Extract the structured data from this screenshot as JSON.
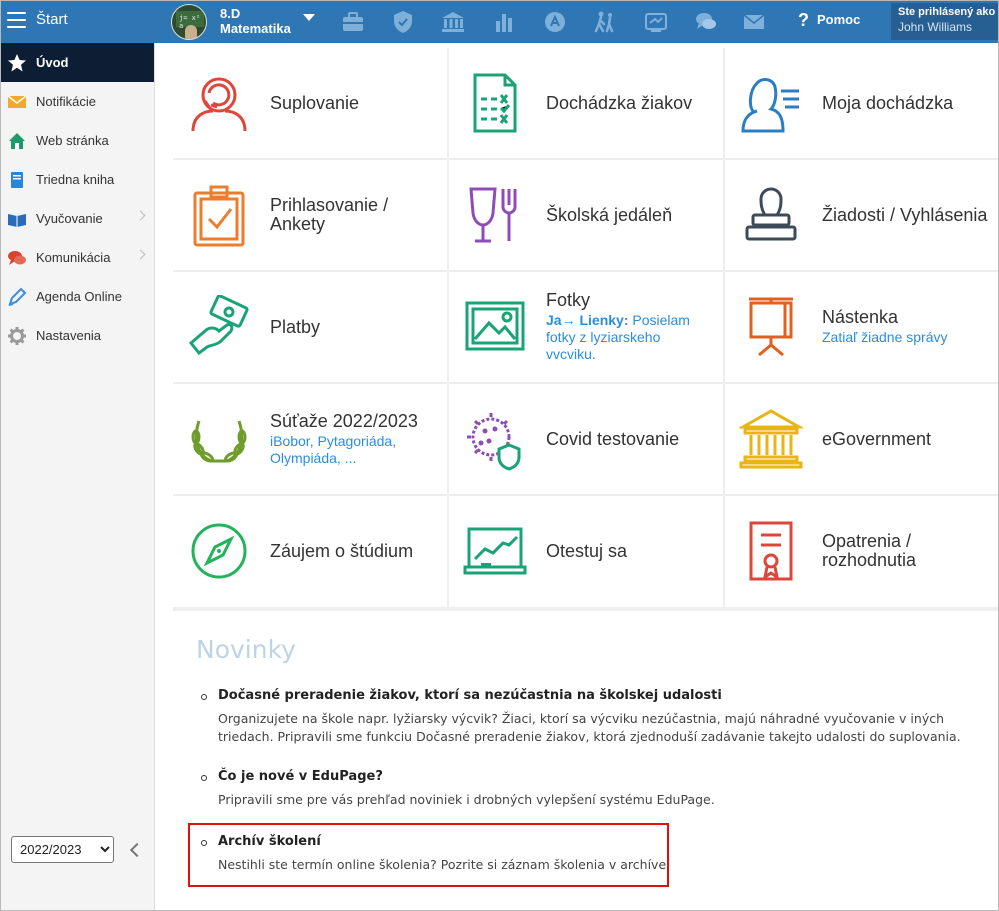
{
  "topbar": {
    "start_label": "Štart",
    "class_line1": "8.D",
    "class_line2": "Matematika",
    "class_avatar_chalk": "j= x² a",
    "icons": [
      "briefcase-icon",
      "shield-icon",
      "bank-icon",
      "bar-chart-icon",
      "teacher-icon",
      "walking-icon",
      "screen-cast-icon",
      "chat-icon",
      "mail-icon"
    ],
    "help_label": "Pomoc",
    "user_line1": "Ste prihlásený ako",
    "user_line2": "John Williams",
    "bar_color": "#2e77b4"
  },
  "sidebar": {
    "items": [
      {
        "label": "Úvod",
        "icon": "star-icon"
      },
      {
        "label": "Notifikácie",
        "icon": "envelope-icon"
      },
      {
        "label": "Web stránka",
        "icon": "home-icon"
      },
      {
        "label": "Triedna kniha",
        "icon": "book-icon"
      },
      {
        "label": "Vyučovanie",
        "icon": "open-book-icon"
      },
      {
        "label": "Komunikácia",
        "icon": "chat-bubbles-icon"
      },
      {
        "label": "Agenda Online",
        "icon": "pen-icon"
      },
      {
        "label": "Nastavenia",
        "icon": "gear-icon"
      }
    ],
    "year": "2022/2023"
  },
  "tiles": [
    {
      "title": "Suplovanie",
      "icon": "substitute-icon"
    },
    {
      "title": "Dochádzka žiakov",
      "icon": "attendance-list-icon"
    },
    {
      "title": "Moja dochádzka",
      "icon": "my-attendance-icon"
    },
    {
      "title": "Prihlasovanie / Ankety",
      "icon": "clipboard-check-icon"
    },
    {
      "title": "Školská jedáleň",
      "icon": "canteen-icon"
    },
    {
      "title": "Žiadosti / Vyhlásenia",
      "icon": "stamp-icon"
    },
    {
      "title": "Platby",
      "icon": "payment-hand-icon"
    },
    {
      "title": "Fotky",
      "sub_bold": "Ja→ Lienky:",
      "sub": " Posielam fotky z lyziarskeho vvcviku.",
      "icon": "photo-icon"
    },
    {
      "title": "Nástenka",
      "sub": "Zatiaľ žiadne správy",
      "icon": "easel-icon"
    },
    {
      "title": "Súťaže 2022/2023",
      "sub": "iBobor, Pytagoriáda, Olympiáda, ...",
      "icon": "laurel-icon"
    },
    {
      "title": "Covid testovanie",
      "icon": "virus-shield-icon"
    },
    {
      "title": "eGovernment",
      "icon": "government-building-icon"
    },
    {
      "title": "Záujem o štúdium",
      "icon": "compass-icon"
    },
    {
      "title": "Otestuj sa",
      "icon": "chart-board-icon"
    },
    {
      "title": "Opatrenia / rozhodnutia",
      "icon": "certificate-icon"
    }
  ],
  "news": {
    "title": "Novinky",
    "items": [
      {
        "heading": "Dočasné preradenie žiakov, ktorí sa nezúčastnia na školskej udalosti",
        "body": "Organizujete na škole napr. lyžiarsky výcvik? Žiaci, ktorí sa výcviku nezúčastnia, majú náhradné vyučovanie v iných triedach. Pripravili sme funkciu Dočasné preradenie žiakov, ktorá zjednoduší zadávanie takejto udalosti do suplovania."
      },
      {
        "heading": "Čo je nové v EduPage?",
        "body": "Pripravili sme pre vás prehľad noviniek i drobných vylepšení systému EduPage."
      },
      {
        "heading": "Archív školení",
        "body": "Nestihli ste termín online školenia? Pozrite si záznam školenia v archíve."
      }
    ]
  }
}
